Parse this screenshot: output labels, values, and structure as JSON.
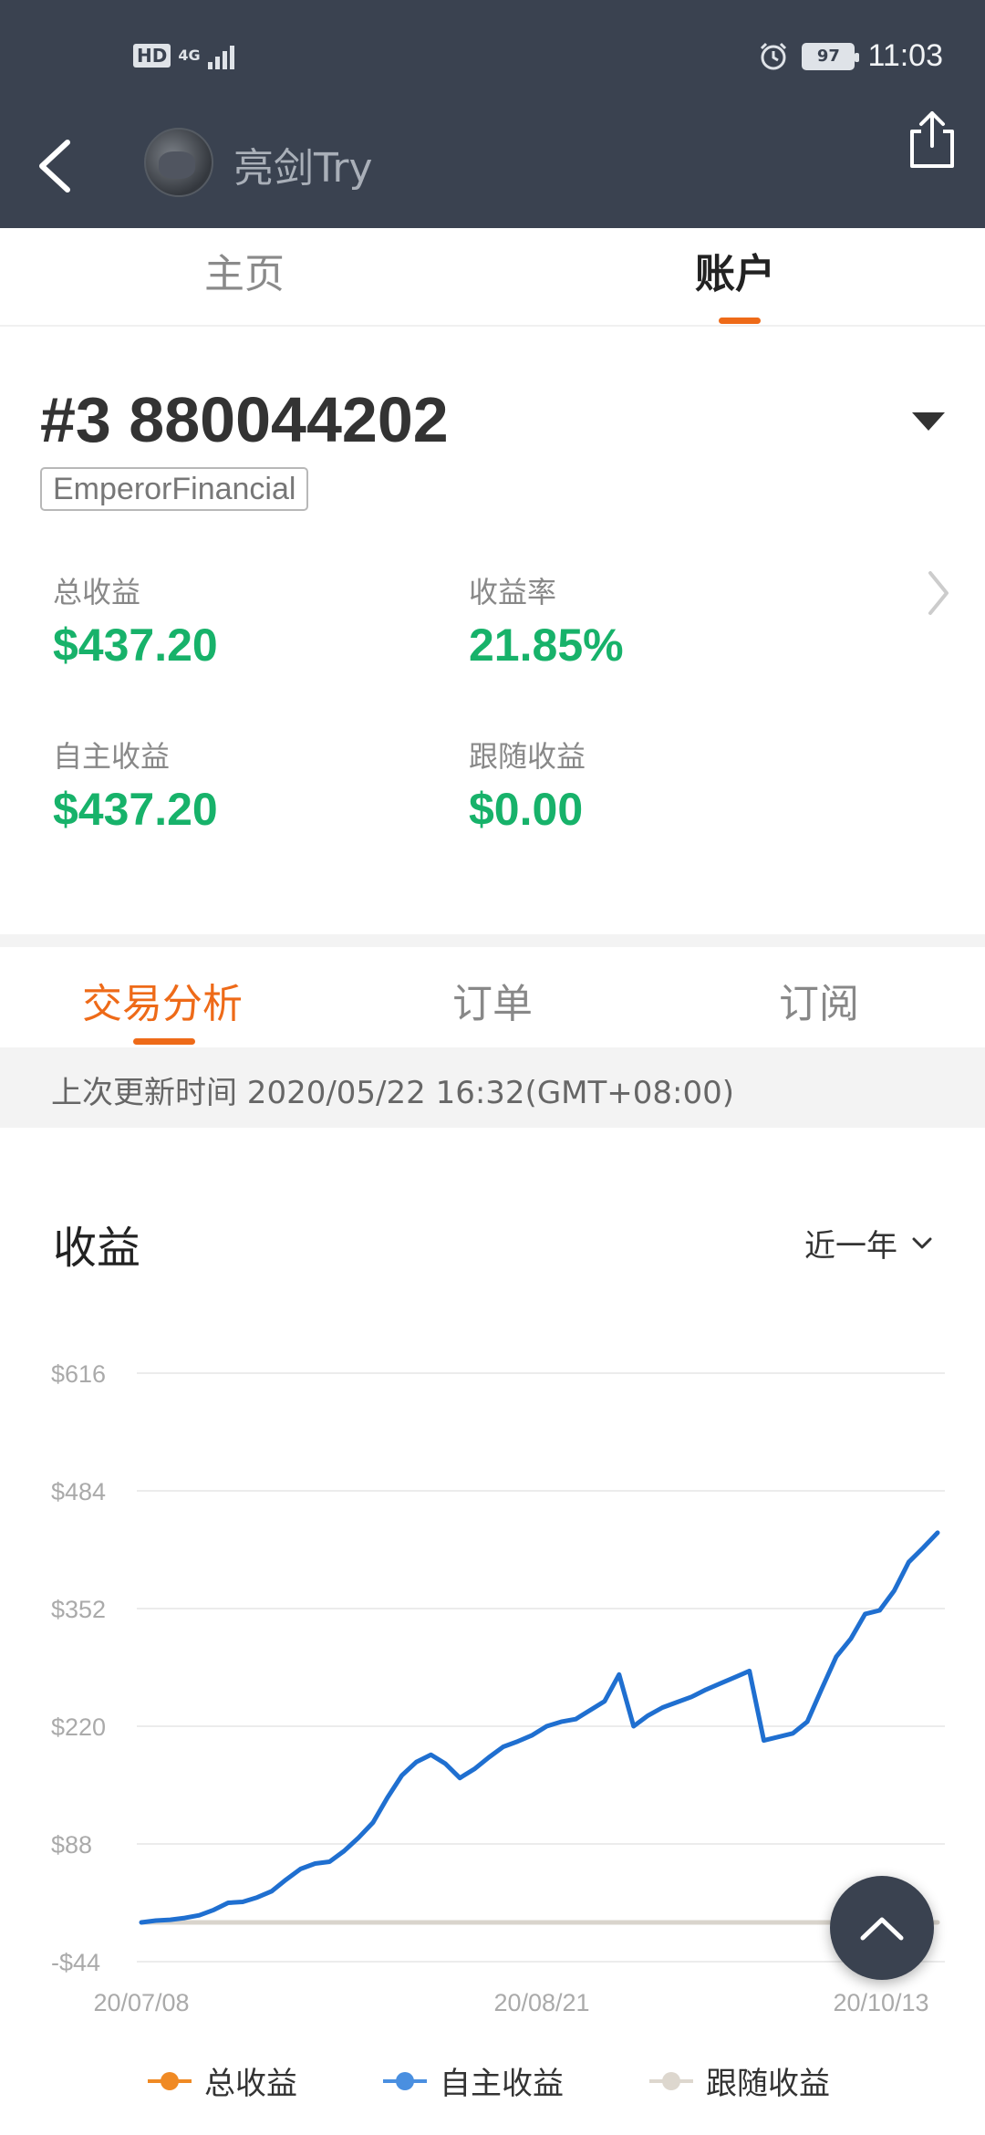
{
  "status_bar": {
    "network": "4G",
    "hd": "HD",
    "battery": "97",
    "time": "11:03"
  },
  "header": {
    "username": "亮剑Try"
  },
  "main_tabs": [
    {
      "label": "主页"
    },
    {
      "label": "账户"
    }
  ],
  "account": {
    "number": "#3 880044202",
    "broker": "EmperorFinancial",
    "stats": [
      {
        "label": "总收益",
        "value": "$437.20"
      },
      {
        "label": "收益率",
        "value": "21.85%"
      },
      {
        "label": "自主收益",
        "value": "$437.20"
      },
      {
        "label": "跟随收益",
        "value": "$0.00"
      }
    ]
  },
  "sub_tabs": [
    {
      "label": "交易分析"
    },
    {
      "label": "订单"
    },
    {
      "label": "订阅"
    }
  ],
  "update": {
    "text": "上次更新时间 2020/05/22 16:32(GMT+08:00)"
  },
  "chart_section": {
    "title": "收益",
    "range_label": "近一年"
  },
  "colors": {
    "accent": "#ee6a18",
    "positive": "#17b26a",
    "line_blue": "#1f6fd0",
    "header_bg": "#3a4250"
  },
  "chart_data": {
    "type": "line",
    "title": "收益",
    "y_ticks": [
      "$616",
      "$484",
      "$352",
      "$220",
      "$88",
      "-$44"
    ],
    "y_tick_values": [
      616,
      484,
      352,
      220,
      88,
      -44
    ],
    "x_tick_labels": [
      "20/07/08",
      "20/08/21",
      "20/10/13"
    ],
    "ylim": [
      -44,
      616
    ],
    "grid": true,
    "legend_position": "bottom",
    "series": [
      {
        "name": "总收益",
        "color": "#f08a24",
        "values": []
      },
      {
        "name": "自主收益",
        "color": "#1f6fd0",
        "values": [
          0,
          2,
          3,
          5,
          8,
          14,
          22,
          23,
          28,
          35,
          48,
          60,
          66,
          68,
          80,
          95,
          112,
          140,
          165,
          180,
          188,
          178,
          162,
          172,
          185,
          197,
          203,
          210,
          220,
          225,
          228,
          238,
          248,
          278,
          220,
          232,
          241,
          247,
          253,
          261,
          268,
          275,
          282,
          204,
          208,
          212,
          225,
          262,
          298,
          318,
          346,
          350,
          372,
          404,
          420,
          437
        ]
      },
      {
        "name": "跟随收益",
        "color": "#d9d4cc",
        "values": [
          0,
          0,
          0,
          0,
          0,
          0,
          0,
          0,
          0,
          0,
          0,
          0,
          0,
          0,
          0,
          0,
          0,
          0,
          0,
          0,
          0,
          0,
          0,
          0,
          0,
          0,
          0,
          0,
          0,
          0,
          0,
          0,
          0,
          0,
          0,
          0,
          0,
          0,
          0,
          0,
          0,
          0,
          0,
          0,
          0,
          0,
          0,
          0,
          0,
          0,
          0,
          0,
          0,
          0,
          0,
          0
        ]
      }
    ]
  }
}
